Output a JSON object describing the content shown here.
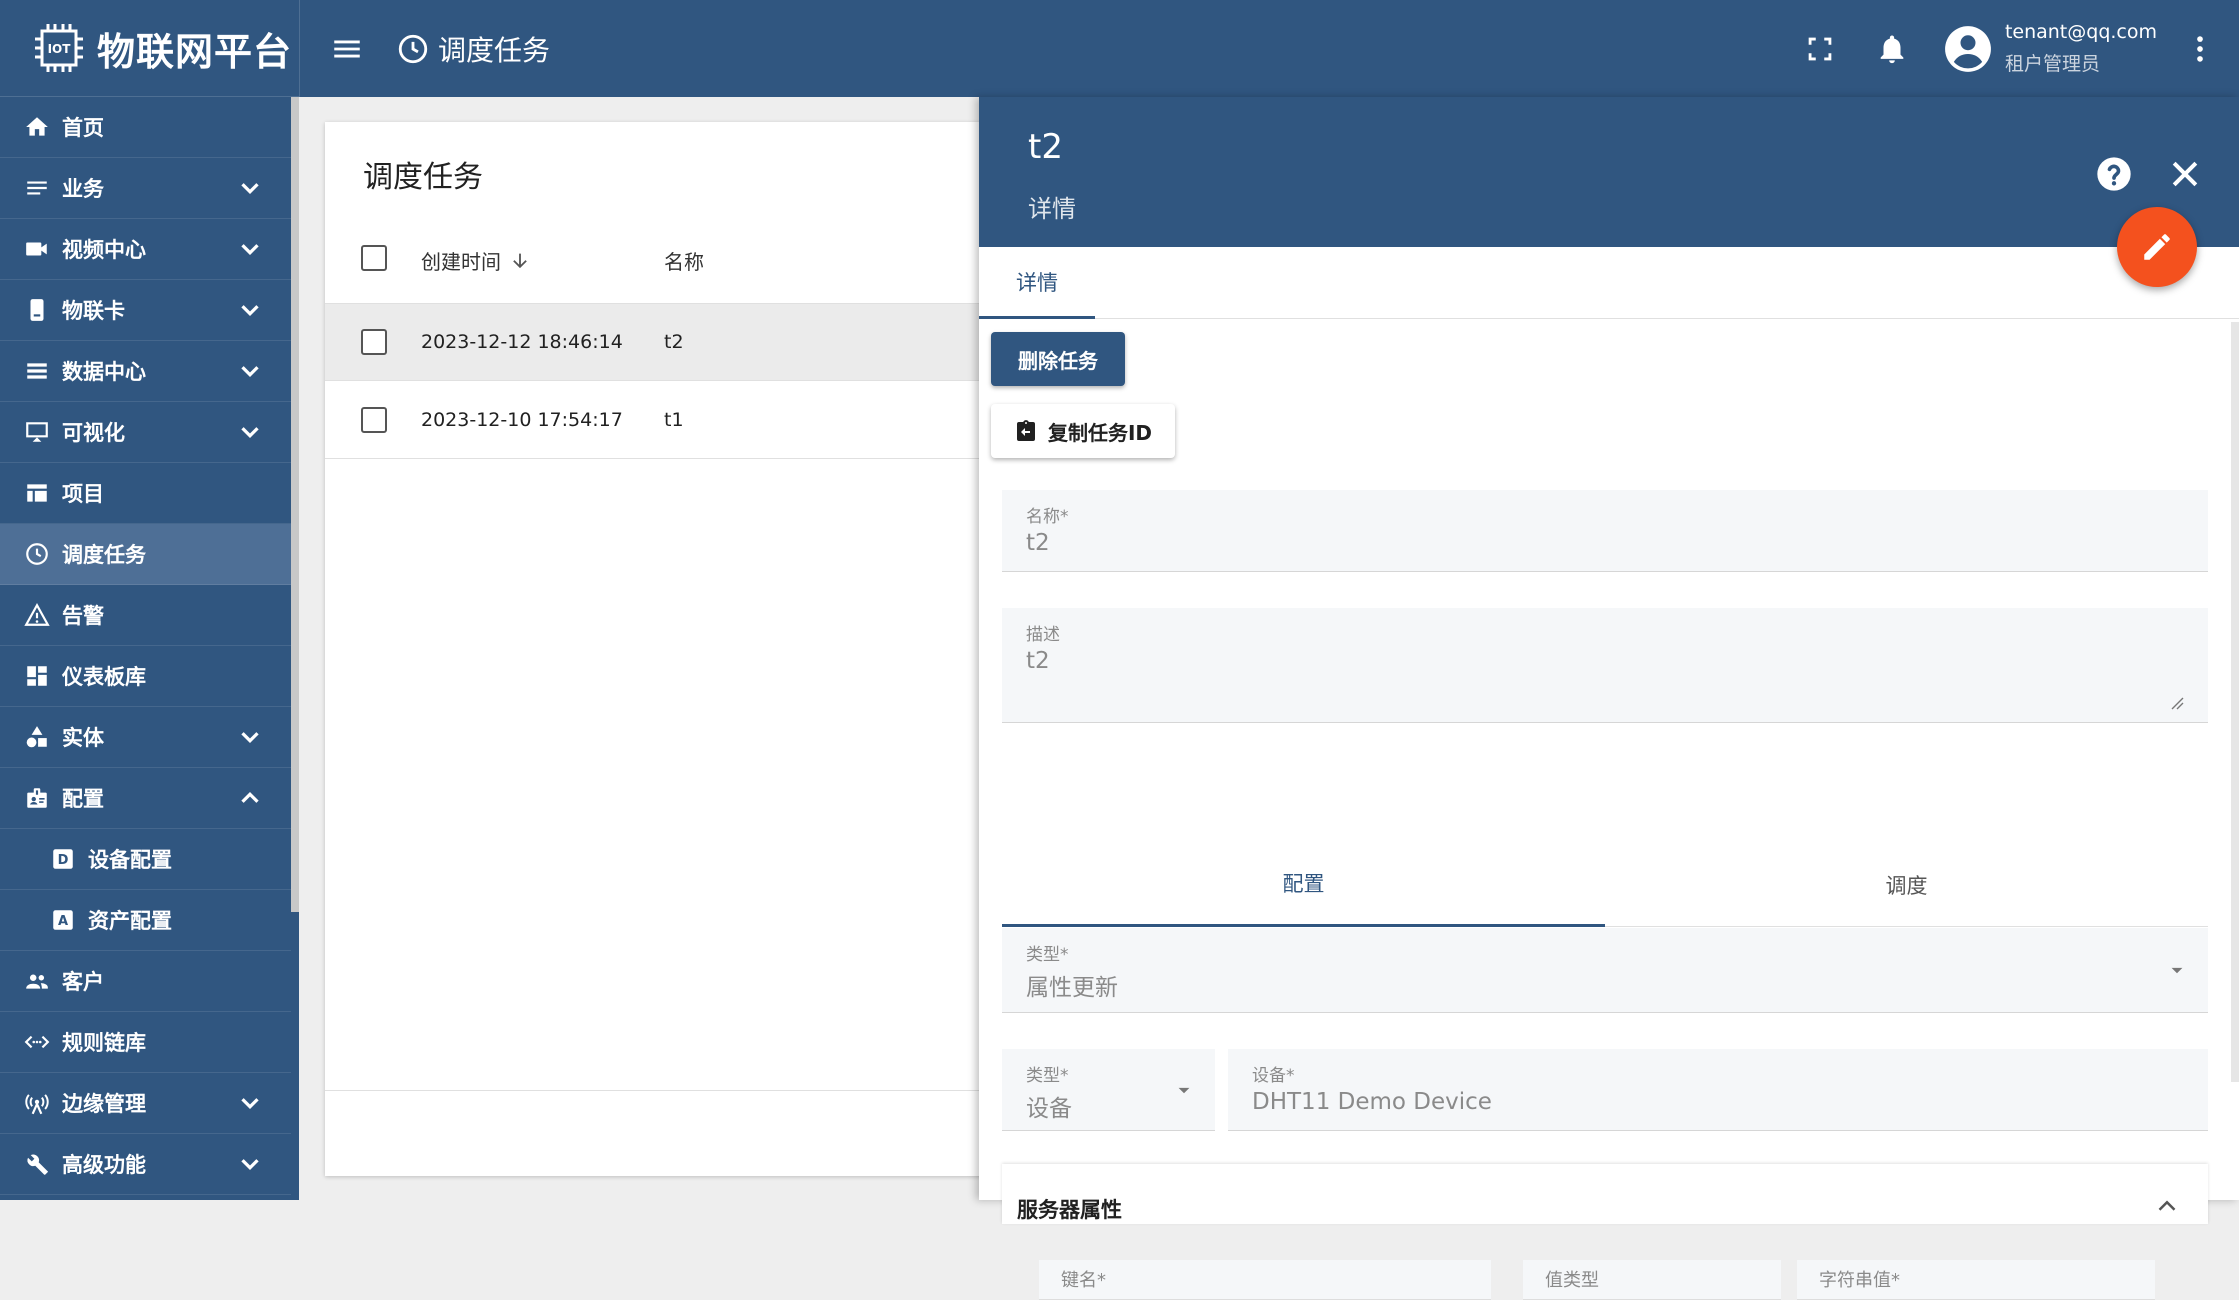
{
  "app": {
    "brand": "物联网平台",
    "logo_icon": "iot-chip-icon"
  },
  "sidebar": {
    "items": [
      {
        "label": "首页",
        "icon": "home-icon",
        "expand": ""
      },
      {
        "label": "业务",
        "icon": "list-icon",
        "expand": "down"
      },
      {
        "label": "视频中心",
        "icon": "video-icon",
        "expand": "down"
      },
      {
        "label": "物联卡",
        "icon": "sim-card-icon",
        "expand": "down"
      },
      {
        "label": "数据中心",
        "icon": "data-icon",
        "expand": "down"
      },
      {
        "label": "可视化",
        "icon": "monitor-icon",
        "expand": "down"
      },
      {
        "label": "项目",
        "icon": "table-icon",
        "expand": ""
      },
      {
        "label": "调度任务",
        "icon": "clock-icon",
        "expand": ""
      },
      {
        "label": "告警",
        "icon": "warning-icon",
        "expand": ""
      },
      {
        "label": "仪表板库",
        "icon": "dashboard-icon",
        "expand": ""
      },
      {
        "label": "实体",
        "icon": "shapes-icon",
        "expand": "down"
      },
      {
        "label": "配置",
        "icon": "badge-icon",
        "expand": "up"
      },
      {
        "label": "设备配置",
        "icon": "device-profile-icon",
        "expand": ""
      },
      {
        "label": "资产配置",
        "icon": "asset-profile-icon",
        "expand": ""
      },
      {
        "label": "客户",
        "icon": "people-icon",
        "expand": ""
      },
      {
        "label": "规则链库",
        "icon": "code-arrows-icon",
        "expand": ""
      },
      {
        "label": "边缘管理",
        "icon": "antenna-icon",
        "expand": "down"
      },
      {
        "label": "高级功能",
        "icon": "tools-icon",
        "expand": "down"
      }
    ]
  },
  "topbar": {
    "title": "调度任务",
    "user_email": "tenant@qq.com",
    "user_role": "租户管理员"
  },
  "list": {
    "title": "调度任务",
    "columns": {
      "created": "创建时间",
      "name": "名称"
    },
    "rows": [
      {
        "created": "2023-12-12 18:46:14",
        "name": "t2"
      },
      {
        "created": "2023-12-10 17:54:17",
        "name": "t1"
      }
    ]
  },
  "detail": {
    "name": "t2",
    "subtitle": "详情",
    "tab": "详情",
    "delete_button": "删除任务",
    "copy_button": "复制任务ID",
    "name_field": {
      "label": "名称*",
      "value": "t2"
    },
    "desc_field": {
      "label": "描述",
      "value": "t2"
    },
    "subtabs": [
      "配置",
      "调度"
    ],
    "type_field": {
      "label": "类型*",
      "value": "属性更新"
    },
    "entity_type_field": {
      "label": "类型*",
      "value": "设备"
    },
    "device_field": {
      "label": "设备*",
      "value": "DHT11 Demo Device"
    },
    "server_attributes": {
      "title": "服务器属性",
      "columns": [
        "键名*",
        "值类型",
        "字符串值*"
      ]
    }
  },
  "colors": {
    "primary": "#305680",
    "accent": "#f4511e",
    "active_menu": "#4e6f96"
  }
}
